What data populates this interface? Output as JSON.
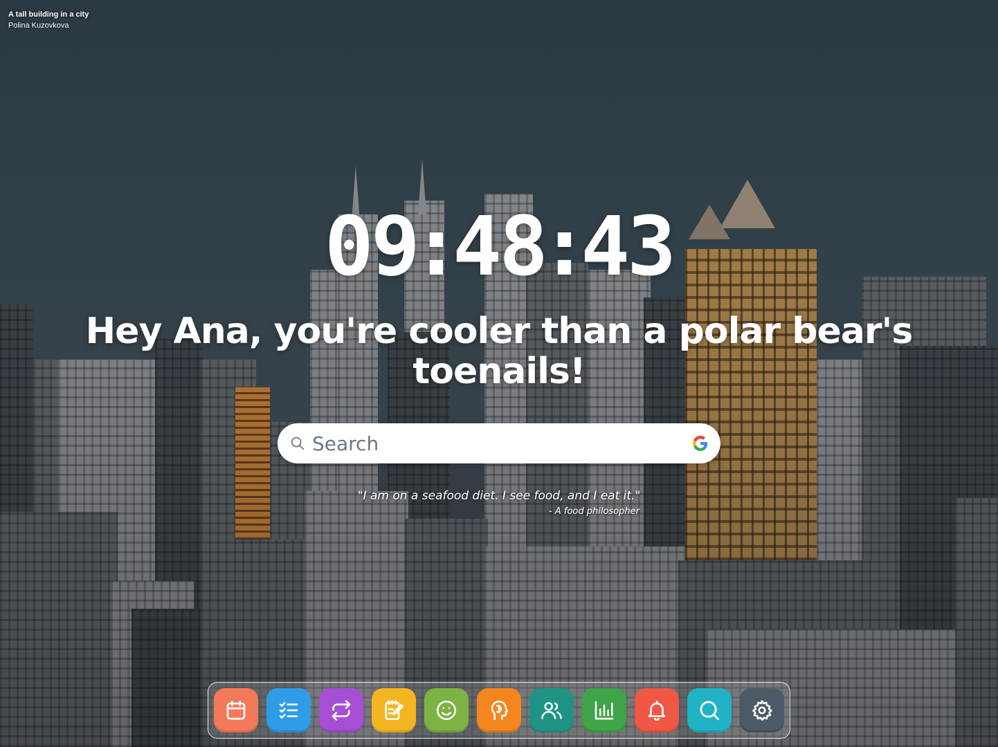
{
  "photo_credit": {
    "title": "A tall building in a city",
    "author": "Polina Kuzovkova"
  },
  "clock": {
    "hours": "09",
    "minutes": "48",
    "seconds": "43",
    "separator": ":"
  },
  "greeting": "Hey Ana, you're cooler than a polar bear's toenails!",
  "search": {
    "placeholder": "Search",
    "value": "",
    "engine_icon": "google-icon"
  },
  "quote": {
    "text": "\"I am on a seafood diet. I see food, and I eat it.\"",
    "author": "- A food philosopher"
  },
  "dock": {
    "items": [
      {
        "name": "calendar",
        "icon": "calendar-icon",
        "color": "#f4795a"
      },
      {
        "name": "todo",
        "icon": "checklist-icon",
        "color": "#2f9ce8"
      },
      {
        "name": "habits",
        "icon": "repeat-icon",
        "color": "#a64fd6"
      },
      {
        "name": "notes",
        "icon": "notepad-icon",
        "color": "#f4b522"
      },
      {
        "name": "mood",
        "icon": "smiley-icon",
        "color": "#7cb342"
      },
      {
        "name": "mind",
        "icon": "brain-head-icon",
        "color": "#f5851f"
      },
      {
        "name": "contacts",
        "icon": "people-icon",
        "color": "#1f9386"
      },
      {
        "name": "stats",
        "icon": "bar-chart-icon",
        "color": "#3fa447"
      },
      {
        "name": "reminders",
        "icon": "bell-icon",
        "color": "#ef5844"
      },
      {
        "name": "search",
        "icon": "search-icon",
        "color": "#20b3c6"
      },
      {
        "name": "settings",
        "icon": "gear-icon",
        "color": "#4b5a66"
      }
    ]
  }
}
